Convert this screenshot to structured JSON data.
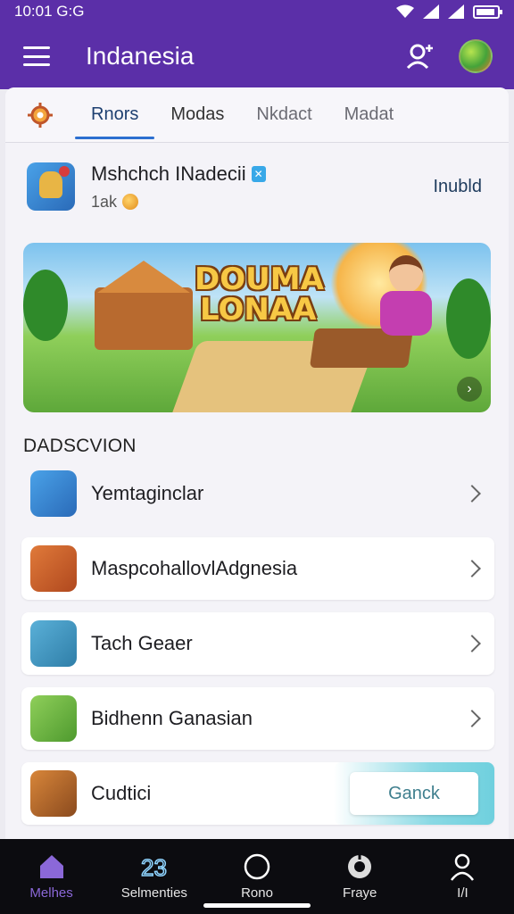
{
  "status_bar": {
    "time": "10:01 G:G"
  },
  "app_bar": {
    "title": "Indanesia",
    "icons": [
      "menu-icon",
      "person-add-icon",
      "avatar"
    ]
  },
  "tabs": [
    {
      "label": "Rnors",
      "active": true
    },
    {
      "label": "Modas",
      "active": false
    },
    {
      "label": "Nkdact",
      "active": false
    },
    {
      "label": "Madat",
      "active": false
    }
  ],
  "game": {
    "name": "Mshchch INadecii",
    "meta": "1ak",
    "action": "Inubld"
  },
  "banner": {
    "title_line1": "DOUMA",
    "title_line2": "LONAA"
  },
  "section": {
    "title": "DADSCVION"
  },
  "list": [
    {
      "label": "Yemtaginclar"
    },
    {
      "label": "MaspcohallovlAdgnesia"
    },
    {
      "label": "Tach Geaer"
    },
    {
      "label": "Bidhenn Ganasian"
    },
    {
      "label": "Cudtici",
      "button": "Ganck"
    }
  ],
  "bottom_nav": [
    {
      "label": "Melhes",
      "icon": "home-icon",
      "active": true
    },
    {
      "label": "Selmenties",
      "icon": "number-icon",
      "active": false
    },
    {
      "label": "Rono",
      "icon": "circle-icon",
      "active": false
    },
    {
      "label": "Fraye",
      "icon": "shield-icon",
      "active": false
    },
    {
      "label": "I/I",
      "icon": "profile-icon",
      "active": false
    }
  ],
  "colors": {
    "primary": "#5b2fa8",
    "active_tab": "#2c6fd0",
    "nav_active": "#8b68d8",
    "button_glow": "#6fd0de"
  }
}
